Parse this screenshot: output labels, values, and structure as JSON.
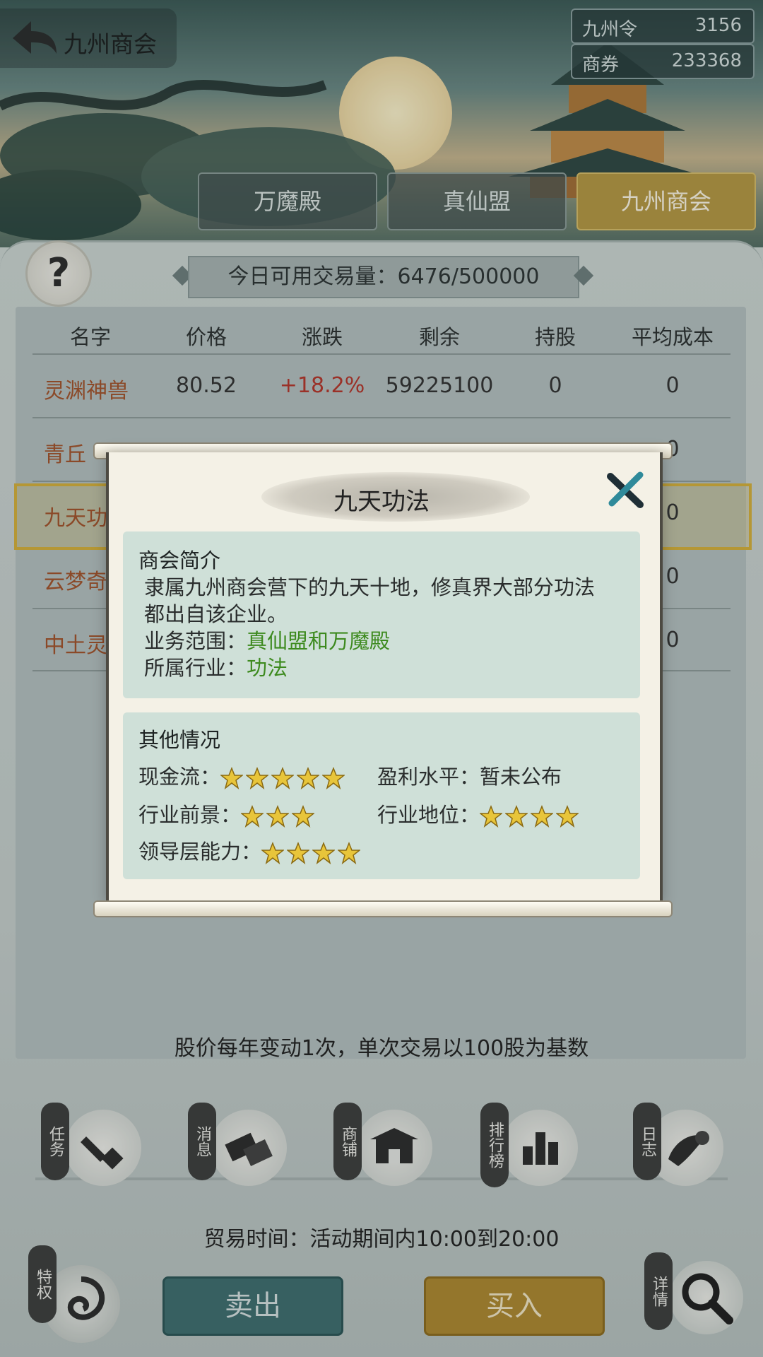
{
  "header": {
    "title": "九州商会",
    "resources": [
      {
        "label": "九州令",
        "value": "3156"
      },
      {
        "label": "商券",
        "value": "233368"
      }
    ]
  },
  "tabs": [
    {
      "label": "万魔殿"
    },
    {
      "label": "真仙盟"
    },
    {
      "label": "九州商会",
      "active": true
    }
  ],
  "volume_text": "今日可用交易量：6476/500000",
  "table": {
    "headers": [
      "名字",
      "价格",
      "涨跌",
      "剩余",
      "持股",
      "平均成本"
    ],
    "rows": [
      {
        "name": "灵渊神兽",
        "price": "80.52",
        "change": "+18.2%",
        "remain": "59225100",
        "held": "0",
        "avg": "0"
      },
      {
        "name": "青丘",
        "held_avg": "0"
      },
      {
        "name": "九天功",
        "held_avg": "0"
      },
      {
        "name": "云梦奇",
        "held_avg": "0"
      },
      {
        "name": "中土灵",
        "held_avg": "0"
      }
    ]
  },
  "footnote": "股价每年变动1次，单次交易以100股为基数",
  "nav": [
    {
      "label": "任务",
      "icon": "quest-icon"
    },
    {
      "label": "消息",
      "icon": "message-icon"
    },
    {
      "label": "商铺",
      "icon": "shop-icon"
    },
    {
      "label": "排行榜",
      "icon": "ranking-icon"
    },
    {
      "label": "日志",
      "icon": "log-icon"
    }
  ],
  "trade_time": "贸易时间：活动期间内10:00到20:00",
  "privilege_label": "特权",
  "detail_label": "详情",
  "sell_label": "卖出",
  "buy_label": "买入",
  "modal": {
    "title": "九天功法",
    "intro_heading": "商会简介",
    "intro_line1": "隶属九州商会营下的九天十地，修真界大部分功法",
    "intro_line2": "都出自该企业。",
    "scope_label": "业务范围：",
    "scope_value": "真仙盟和万魔殿",
    "industry_label": "所属行业：",
    "industry_value": "功法",
    "other_heading": "其他情况",
    "ratings": {
      "cashflow_label": "现金流：",
      "cashflow_stars": 5,
      "profit_label": "盈利水平：",
      "profit_value": "暂未公布",
      "prospect_label": "行业前景：",
      "prospect_stars": 3,
      "position_label": "行业地位：",
      "position_stars": 4,
      "leadership_label": "领导层能力：",
      "leadership_stars": 4
    }
  }
}
